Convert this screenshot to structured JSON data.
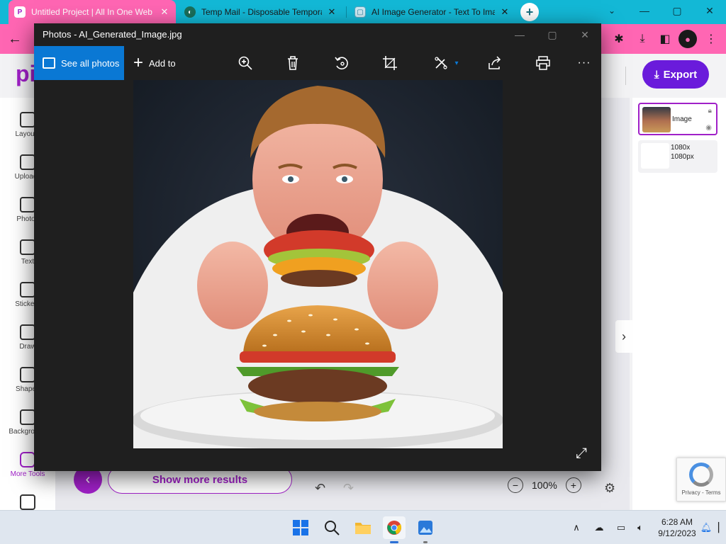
{
  "browser": {
    "tabs": [
      {
        "title": "Untitled Project | All In One Web",
        "active": true
      },
      {
        "title": "Temp Mail - Disposable Tempora",
        "active": false
      },
      {
        "title": "AI Image Generator - Text To Ima",
        "active": false
      }
    ],
    "new_tab": "+",
    "close": "✕",
    "win_min": "—",
    "win_max": "▢",
    "win_close": "✕",
    "nav_back": "←",
    "ext_icons": {
      "puzzle": "✱",
      "download": "⤓",
      "sidebar": "◧",
      "profile": "●",
      "menu": "⋮"
    }
  },
  "app": {
    "logo": "pi",
    "export": "Export",
    "rail": [
      "Layouts",
      "Uploads",
      "Photos",
      "Text",
      "Stickers",
      "Draw",
      "Shapes",
      "Background",
      "More Tools"
    ],
    "layers": [
      {
        "label": "Image"
      },
      {
        "label": "1080x 1080px"
      }
    ],
    "show_more": "Show more results",
    "zoom": "100%",
    "recaptcha": "Privacy - Terms"
  },
  "photos": {
    "title": "Photos - AI_Generated_Image.jpg",
    "see_all": "See all photos",
    "add_to": "Add to",
    "icons": [
      "zoom-in-icon",
      "delete-icon",
      "rotate-icon",
      "crop-icon",
      "edit-icon",
      "share-icon",
      "print-icon",
      "more-icon"
    ]
  },
  "taskbar": {
    "time": "6:28 AM",
    "date": "9/12/2023"
  },
  "colors": {
    "chrome_tabstrip": "#13b8d6",
    "chrome_toolbar": "#ff66b3",
    "app_accent": "#a020c8",
    "export_btn": "#6a1bdb",
    "photos_blue": "#0a78d4",
    "photos_bg": "#1f1f1f"
  }
}
